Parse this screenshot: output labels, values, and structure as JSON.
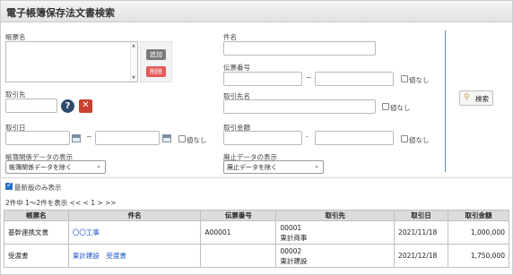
{
  "page": {
    "title": "電子帳簿保存法文書検索"
  },
  "form": {
    "ledger_name_label": "帳票名",
    "add_label": "追加",
    "delete_label": "削除",
    "subject_label": "件名",
    "slip_no_label": "伝票番号",
    "no_value_label": "値なし",
    "client_label": "取引先",
    "client_name_label": "取引先名",
    "trade_date_label": "取引日",
    "trade_amount_label": "取引金額",
    "range_tilde": "~",
    "range_dash": "-",
    "ledger_related_label": "帳簿関係データの表示",
    "ledger_related_value": "帳簿関係データを除く",
    "deleted_label": "廃止データの表示",
    "deleted_value": "廃止データを除く",
    "latest_only_label": "最新版のみ表示",
    "search_label": "検索"
  },
  "pager": {
    "text": "2件中 1〜2件を表示  << < 1 > >>"
  },
  "table": {
    "headers": [
      "帳票名",
      "件名",
      "伝票番号",
      "取引先",
      "取引日",
      "取引金額"
    ],
    "rows": [
      {
        "ledger": "基幹連携文書",
        "subject": "〇〇工事",
        "slip": "A00001",
        "client_code": "00001",
        "client_name": "東計商事",
        "date": "2021/11/18",
        "amount": "1,000,000"
      },
      {
        "ledger": "受渡書",
        "subject": "東計建設　受渡書",
        "slip": "",
        "client_code": "00002",
        "client_name": "東計建設",
        "date": "2021/12/18",
        "amount": "1,750,000"
      }
    ]
  },
  "colors": {
    "accent_blue": "#1f6fd1",
    "link": "#1a56c7",
    "delete_red": "#e65a5a",
    "clear_red": "#c8412f"
  }
}
